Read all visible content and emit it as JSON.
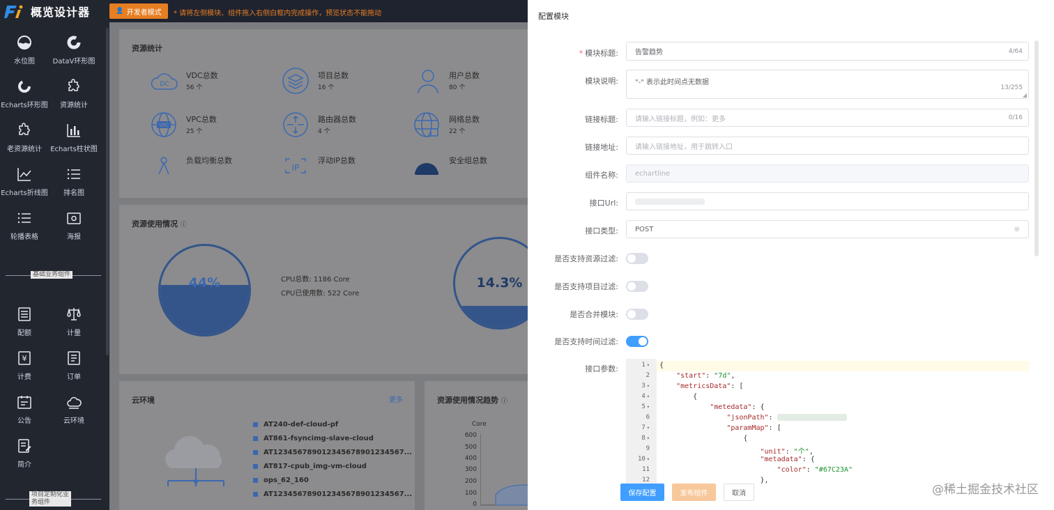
{
  "app": {
    "title": "概览设计器"
  },
  "sidebar": {
    "components": [
      {
        "label": "水位图",
        "icon": "water-level-icon"
      },
      {
        "label": "DataV环形图",
        "icon": "ring-chart-icon"
      },
      {
        "label": "Echarts环形图",
        "icon": "echarts-ring-icon"
      },
      {
        "label": "资源统计",
        "icon": "puzzle-icon"
      },
      {
        "label": "老资源统计",
        "icon": "puzzle-icon"
      },
      {
        "label": "Echarts柱状图",
        "icon": "bar-chart-icon"
      },
      {
        "label": "Echarts折线图",
        "icon": "line-chart-icon"
      },
      {
        "label": "排名图",
        "icon": "list-icon"
      },
      {
        "label": "轮播表格",
        "icon": "list-icon"
      },
      {
        "label": "海报",
        "icon": "poster-icon"
      }
    ],
    "group_basic": "基础业务组件",
    "business": [
      {
        "label": "配额",
        "icon": "quota-icon"
      },
      {
        "label": "计量",
        "icon": "scale-icon"
      },
      {
        "label": "计费",
        "icon": "yuan-icon"
      },
      {
        "label": "订单",
        "icon": "order-icon"
      },
      {
        "label": "公告",
        "icon": "notice-icon"
      },
      {
        "label": "云环境",
        "icon": "cloud-icon"
      },
      {
        "label": "简介",
        "icon": "intro-icon"
      }
    ],
    "group_custom_1": "项目定制化业",
    "group_custom_2": "务组件"
  },
  "topbar": {
    "dev_mode": "开发者模式",
    "hint": "* 请将左侧模块、组件拖入右侧白框内完成操作，预览状态不能拖动"
  },
  "canvas": {
    "resource_stats": {
      "title": "资源统计",
      "items": [
        {
          "name": "VDC总数",
          "value": "56 个",
          "icon": "vdc-cloud-icon"
        },
        {
          "name": "项目总数",
          "value": "16 个",
          "icon": "layers-icon"
        },
        {
          "name": "用户总数",
          "value": "80 个",
          "icon": "users-icon"
        },
        {
          "name": "VPC总数",
          "value": "25 个",
          "icon": "vpc-globe-icon"
        },
        {
          "name": "路由器总数",
          "value": "4 个",
          "icon": "router-icon"
        },
        {
          "name": "网络总数",
          "value": "22 个",
          "icon": "network-globe-icon"
        },
        {
          "name": "负载均衡总数",
          "value": "",
          "icon": "load-balancer-icon"
        },
        {
          "name": "浮动IP总数",
          "value": "",
          "icon": "floating-ip-icon"
        },
        {
          "name": "安全组总数",
          "value": "",
          "icon": "security-group-icon"
        }
      ]
    },
    "usage": {
      "title": "资源使用情况",
      "gauge1_pct": "44%",
      "gauge1_fill": 0.44,
      "gauge2_pct": "14.3%",
      "gauge2_fill": 0.143,
      "cpu_total": "CPU总数:  1186 Core",
      "cpu_used": "CPU已使用数:  522 Core"
    },
    "cloud_env": {
      "title": "云环境",
      "more": "更多",
      "items": [
        "AT240-def-cloud-pf",
        "AT861-fsyncimg-slave-cloud",
        "AT123456789012345678901234567...",
        "AT817-cpub_img-vm-cloud",
        "ops_62_160",
        "AT123456789012345678901234567..."
      ]
    },
    "trend": {
      "title": "资源使用情况趋势",
      "unit": "Core",
      "ticks": [
        "600",
        "500",
        "400",
        "300",
        "200",
        "100",
        "0"
      ]
    }
  },
  "drawer": {
    "title": "配置模块",
    "fields": {
      "module_title": {
        "label": "模块标题:",
        "value": "告警趋势",
        "count": "4/64"
      },
      "module_desc": {
        "label": "模块说明:",
        "value": "\"-\" 表示此时间点无数据",
        "count": "13/255"
      },
      "link_title": {
        "label": "链接标题:",
        "placeholder": "请输入链接标题，例如：更多",
        "count": "0/16"
      },
      "link_url": {
        "label": "链接地址:",
        "placeholder": "请输入链接地址，用于跳转入口"
      },
      "component_name": {
        "label": "组件名称:",
        "value": "echartline"
      },
      "api_url": {
        "label": "接口Url:"
      },
      "api_type": {
        "label": "接口类型:",
        "value": "POST"
      },
      "support_resource_filter": {
        "label": "是否支持资源过滤:"
      },
      "support_project_filter": {
        "label": "是否支持项目过滤:"
      },
      "merge_module": {
        "label": "是否合并模块:"
      },
      "support_time_filter": {
        "label": "是否支持时间过滤:"
      },
      "api_params": {
        "label": "接口参数:"
      }
    },
    "code": {
      "line_numbers": [
        "1",
        "2",
        "3",
        "4",
        "5",
        "6",
        "7",
        "8",
        "9",
        "10",
        "11",
        "12"
      ],
      "brace_open": "{",
      "start_key": "\"start\"",
      "start_val": "\"7d\"",
      "metrics_key": "\"metricsData\"",
      "metedata_key": "\"metedata\"",
      "jsonpath_key": "\"jsonPath\"",
      "parammap_key": "\"paramMap\"",
      "unit_key": "\"unit\"",
      "unit_val": "\"个\"",
      "metadata_key": "\"metadata\"",
      "color_key": "\"color\"",
      "color_val": "\"#67C23A\""
    },
    "buttons": {
      "save": "保存配置",
      "publish": "发布组件",
      "cancel": "取消"
    }
  },
  "watermark": "@稀土掘金技术社区",
  "colors": {
    "primary": "#409eff",
    "warning": "#e67e22",
    "sidebar": "#22262f",
    "green": "#67C23A"
  }
}
